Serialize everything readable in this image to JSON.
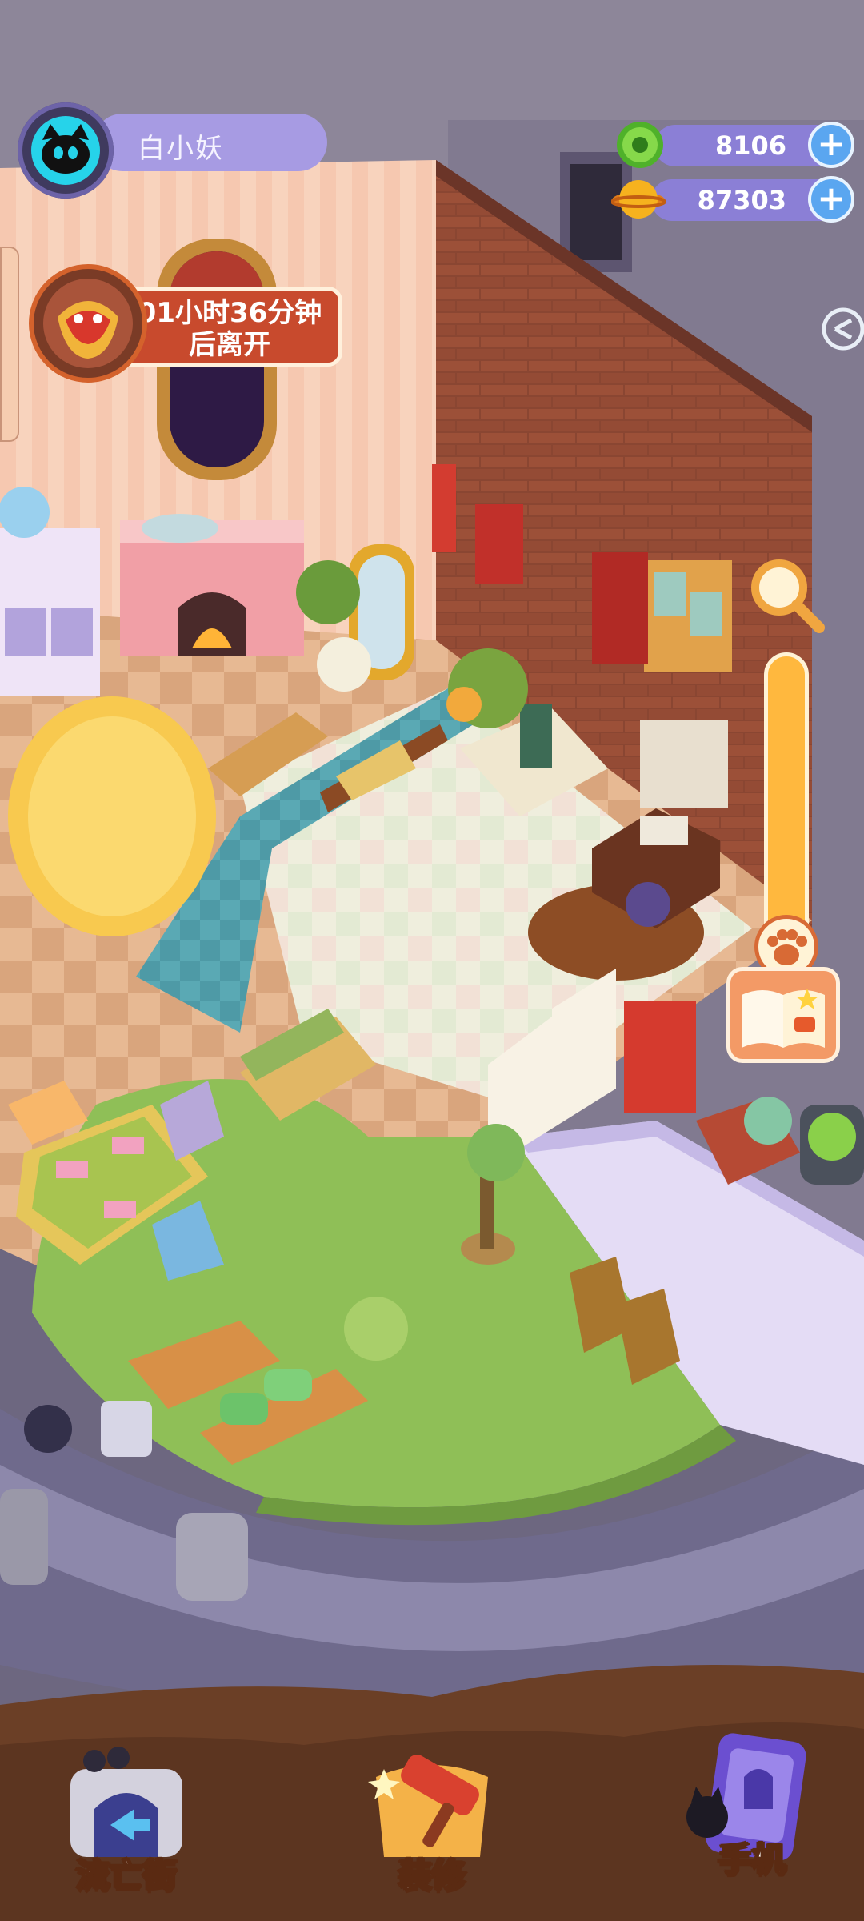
{
  "player": {
    "name": "白小妖",
    "avatar_icon": "cyan-cat-avatar-icon"
  },
  "currencies": [
    {
      "name": "green-gem",
      "value": "8106",
      "icon": "green-coin-icon",
      "color": "#6ccf2e"
    },
    {
      "name": "gold-coin",
      "value": "87303",
      "icon": "planet-coin-icon",
      "color": "#f6b21e"
    }
  ],
  "visitor_timer": {
    "text": "01小时36分钟\n后离开",
    "icon": "lion-dance-portrait-icon"
  },
  "side_controls": {
    "zoom_icon": "magnifier-icon",
    "slider_handle_icon": "paw-icon",
    "book_icon": "catalog-book-icon"
  },
  "bottom_nav": [
    {
      "label": "流亡街",
      "icon": "street-gate-icon"
    },
    {
      "label": "装修",
      "icon": "paint-roller-icon"
    },
    {
      "label": "手机",
      "icon": "phone-icon"
    }
  ],
  "colors": {
    "accent_purple": "#8b7fd6",
    "timer_red": "#c84a2d",
    "slider_orange": "#ffb83e",
    "plus_blue": "#5aa6f0"
  }
}
